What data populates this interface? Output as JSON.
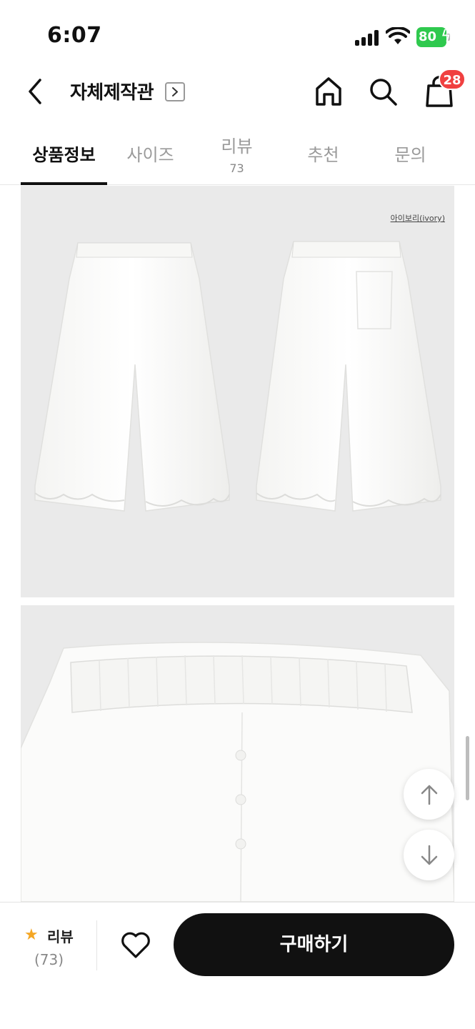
{
  "status": {
    "time": "6:07",
    "battery": "80"
  },
  "header": {
    "title": "자체제작관",
    "cart_count": "28"
  },
  "tabs": [
    {
      "label": "상품정보",
      "active": true
    },
    {
      "label": "사이즈"
    },
    {
      "label": "리뷰",
      "count": "73"
    },
    {
      "label": "추천"
    },
    {
      "label": "문의"
    }
  ],
  "content": {
    "color_caption": "아이보리(ivory)"
  },
  "bottom": {
    "review_label": "리뷰",
    "review_count": "(73)",
    "buy_label": "구매하기"
  },
  "colors": {
    "accent": "#111111",
    "badge": "#f04040",
    "battery": "#2fc94e",
    "star": "#f4a623",
    "image_bg": "#eaeaea"
  }
}
